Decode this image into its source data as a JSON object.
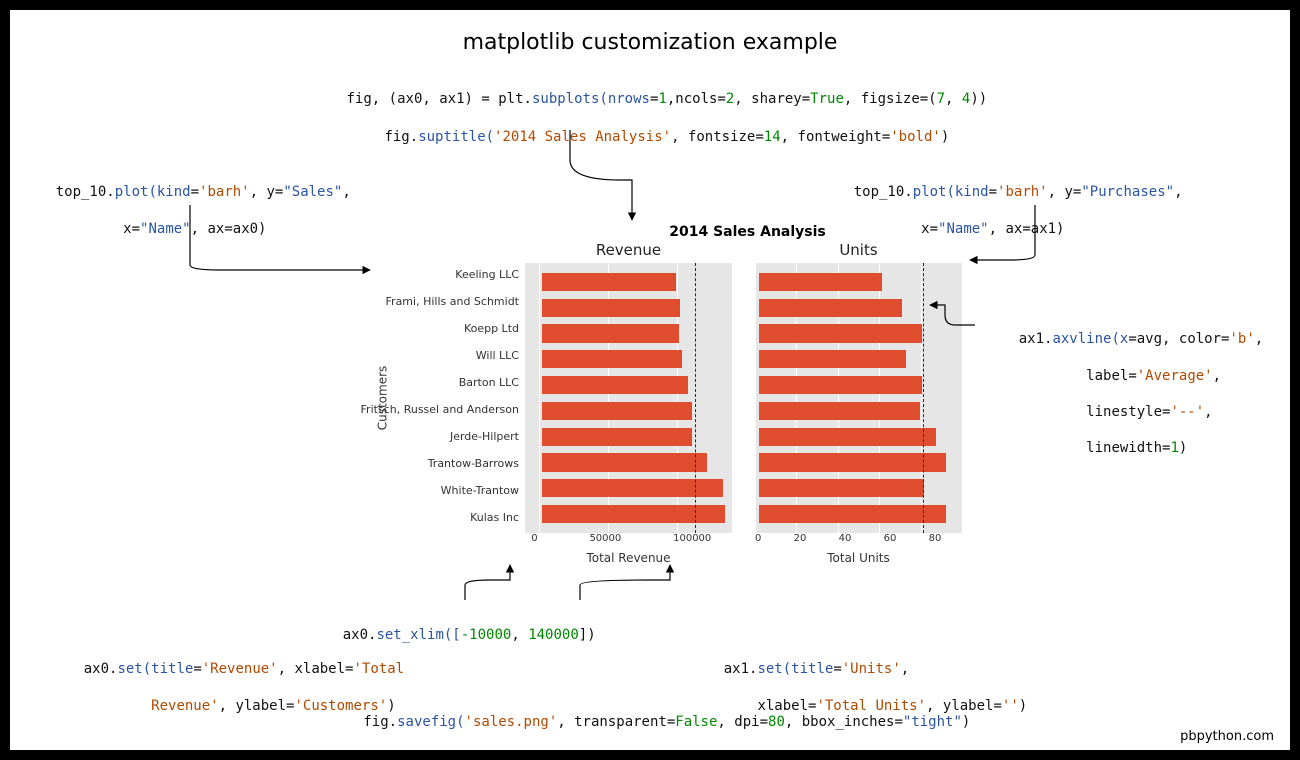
{
  "page_title": "matplotlib customization example",
  "credit": "pbpython.com",
  "code": {
    "line1a": "fig, (ax0, ax1) ",
    "line1b": " plt",
    "line1c": "subplots(nrows",
    "line1d": "1",
    "line1e": ",ncols",
    "line1f": "2",
    "line1g": ", sharey",
    "line1h": "True",
    "line1i": ", figsize",
    "line1j": "7",
    "line1k": ", ",
    "line1l": "4",
    "line1m": "))",
    "line2a": "fig",
    "line2b": "suptitle(",
    "line2c": "'2014 Sales Analysis'",
    "line2d": ", fontsize",
    "line2e": "14",
    "line2f": ", fontweight",
    "line2g": "'bold'",
    "line2h": ")",
    "line3a": "top_10",
    "line3b": "plot(kind",
    "line3c": "'barh'",
    "line3d": ", y",
    "line3e": "\"Sales\"",
    "line3f": ",",
    "line3g": "x",
    "line3h": "\"Name\"",
    "line3i": ", ax",
    "line3j": "ax0)",
    "line4a": "top_10",
    "line4b": "plot(kind",
    "line4c": "'barh'",
    "line4d": ", y",
    "line4e": "\"Purchases\"",
    "line4f": ",",
    "line4g": "x",
    "line4h": "\"Name\"",
    "line4i": ", ax",
    "line4j": "ax1)",
    "line5a": "ax1",
    "line5b": "axvline(x",
    "line5c": "avg, color",
    "line5d": "'b'",
    "line5e": ",",
    "line5f": "label",
    "line5g": "'Average'",
    "line5h": ",",
    "line5i": "linestyle",
    "line5j": "'--'",
    "line5k": ",",
    "line5l": "linewidth",
    "line5m": "1",
    "line5n": ")",
    "line6a": "ax0",
    "line6b": "set_xlim([",
    "line6c": "-10000",
    "line6d": ", ",
    "line6e": "140000",
    "line6f": "])",
    "line7a": "ax0",
    "line7b": "set(title",
    "line7c": "'Revenue'",
    "line7d": ", xlabel",
    "line7e": "'Total",
    "line7f": "Revenue'",
    "line7g": ", ylabel",
    "line7h": "'Customers'",
    "line7i": ")",
    "line8a": "ax1",
    "line8b": "set(title",
    "line8c": "'Units'",
    "line8d": ",",
    "line8e": "xlabel",
    "line8f": "'Total Units'",
    "line8g": ", ylabel",
    "line8h": "''",
    "line8i": ")",
    "line9a": "fig",
    "line9b": "savefig(",
    "line9c": "'sales.png'",
    "line9d": ", transparent",
    "line9e": "False",
    "line9f": ", dpi",
    "line9g": "80",
    "line9h": ", bbox_inches",
    "line9i": "\"tight\"",
    "line9j": ")"
  },
  "chart_data": [
    {
      "type": "bar",
      "orientation": "horizontal",
      "title": "Revenue",
      "xlabel": "Total Revenue",
      "ylabel": "Customers",
      "categories": [
        "Keeling LLC",
        "Frami, Hills and Schmidt",
        "Koepp Ltd",
        "Will LLC",
        "Barton LLC",
        "Fritsch, Russel and Anderson",
        "Jerde-Hilpert",
        "Trantow-Barrows",
        "White-Trantow",
        "Kulas Inc"
      ],
      "values": [
        101000,
        104000,
        103000,
        105000,
        110000,
        113000,
        113000,
        124000,
        136000,
        138000
      ],
      "xlim": [
        -10000,
        140000
      ],
      "xticks": [
        0,
        50000,
        100000
      ],
      "avg_line": 113000
    },
    {
      "type": "bar",
      "orientation": "horizontal",
      "title": "Units",
      "xlabel": "Total Units",
      "ylabel": "",
      "categories": [
        "Keeling LLC",
        "Frami, Hills and Schmidt",
        "Koepp Ltd",
        "Will LLC",
        "Barton LLC",
        "Fritsch, Russel and Anderson",
        "Jerde-Hilpert",
        "Trantow-Barrows",
        "White-Trantow",
        "Kulas Inc"
      ],
      "values": [
        62,
        72,
        82,
        74,
        82,
        81,
        89,
        94,
        83,
        94
      ],
      "xlim": [
        0,
        100
      ],
      "xticks": [
        0,
        20,
        40,
        60,
        80
      ],
      "avg_line": 81
    }
  ],
  "chart_labels": {
    "suptitle": "2014 Sales Analysis",
    "sub0_title": "Revenue",
    "sub1_title": "Units",
    "sub0_xlabel": "Total Revenue",
    "sub1_xlabel": "Total Units",
    "ylabel": "Customers",
    "xticks0": {
      "t0": "0",
      "t1": "50000",
      "t2": "100000"
    },
    "xticks1": {
      "t0": "0",
      "t1": "20",
      "t2": "40",
      "t3": "60",
      "t4": "80"
    }
  },
  "customers": {
    "c0": "Keeling LLC",
    "c1": "Frami, Hills and Schmidt",
    "c2": "Koepp Ltd",
    "c3": "Will LLC",
    "c4": "Barton LLC",
    "c5": "Fritsch, Russel and Anderson",
    "c6": "Jerde-Hilpert",
    "c7": "Trantow-Barrows",
    "c8": "White-Trantow",
    "c9": "Kulas Inc"
  }
}
